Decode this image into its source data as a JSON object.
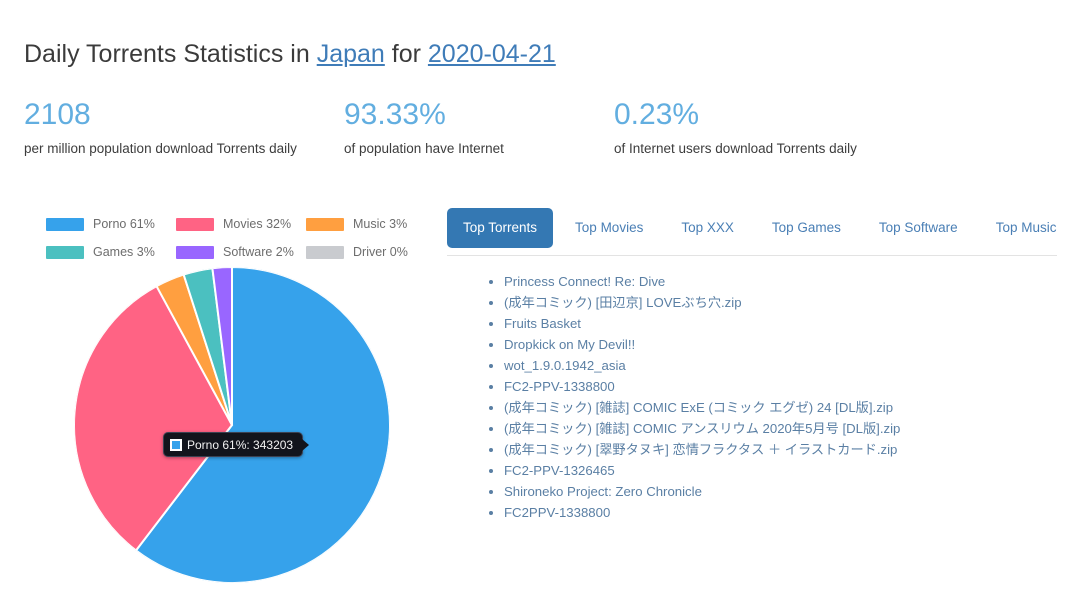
{
  "header": {
    "title_prefix": "Daily Torrents Statistics in ",
    "country": "Japan",
    "title_middle": " for ",
    "date": "2020-04-21"
  },
  "stats": [
    {
      "value": "2108",
      "label": "per million population download Torrents daily"
    },
    {
      "value": "93.33%",
      "label": "of population have Internet"
    },
    {
      "value": "0.23%",
      "label": "of Internet users download Torrents daily"
    }
  ],
  "legend": [
    {
      "label": "Porno 61%",
      "color": "#36a2eb"
    },
    {
      "label": "Movies 32%",
      "color": "#ff6384"
    },
    {
      "label": "Music 3%",
      "color": "#ff9f40"
    },
    {
      "label": "Games 3%",
      "color": "#4bc0c0"
    },
    {
      "label": "Software 2%",
      "color": "#9966ff"
    },
    {
      "label": "Driver 0%",
      "color": "#c9cbcf"
    }
  ],
  "tooltip": {
    "text": "Porno 61%: 343203",
    "swatch_color": "#36a2eb"
  },
  "tabs": [
    {
      "label": "Top Torrents",
      "active": true
    },
    {
      "label": "Top Movies",
      "active": false
    },
    {
      "label": "Top XXX",
      "active": false
    },
    {
      "label": "Top Games",
      "active": false
    },
    {
      "label": "Top Software",
      "active": false
    },
    {
      "label": "Top Music",
      "active": false
    }
  ],
  "torrents": [
    "Princess Connect! Re: Dive",
    "(成年コミック) [田辺京] LOVEぶち穴.zip",
    "Fruits Basket",
    "Dropkick on My Devil!!",
    "wot_1.9.0.1942_asia",
    "FC2-PPV-1338800",
    "(成年コミック) [雑誌] COMIC ExE (コミック エグゼ) 24 [DL版].zip",
    "(成年コミック) [雑誌] COMIC アンスリウム 2020年5月号 [DL版].zip",
    "(成年コミック) [翠野タヌキ] 恋情フラクタス ＋ イラストカード.zip",
    "FC2-PPV-1326465",
    "Shironeko Project: Zero Chronicle",
    "FC2PPV-1338800"
  ],
  "chart_data": {
    "type": "pie",
    "title": "Daily Torrents Statistics in Japan for 2020-04-21",
    "categories": [
      "Porno",
      "Movies",
      "Music",
      "Games",
      "Software",
      "Driver"
    ],
    "values": [
      61,
      32,
      3,
      3,
      2,
      0
    ],
    "value_unit": "percent",
    "absolute_values": {
      "Porno": 343203
    },
    "colors": [
      "#36a2eb",
      "#ff6384",
      "#ff9f40",
      "#4bc0c0",
      "#9966ff",
      "#c9cbcf"
    ],
    "legend_position": "top",
    "start_angle_deg": 0,
    "direction": "clockwise",
    "highlighted_slice": "Porno",
    "tooltip_label": "Porno 61%: 343203"
  }
}
